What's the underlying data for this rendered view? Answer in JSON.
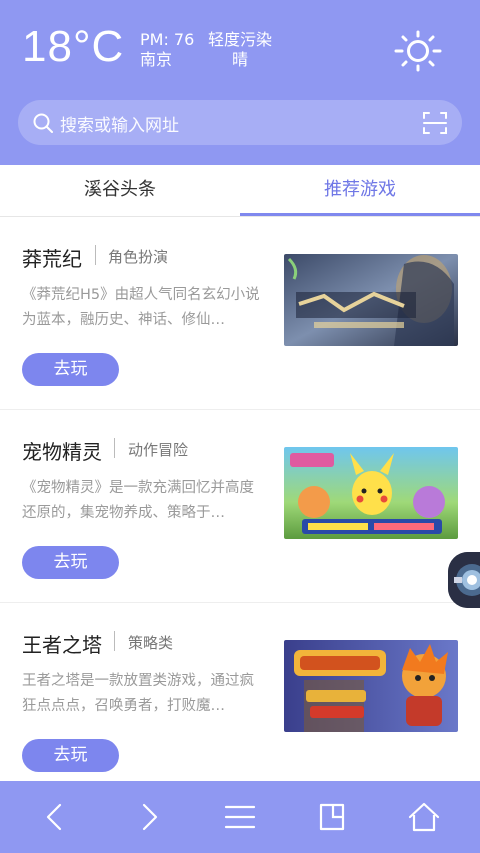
{
  "weather": {
    "temperature": "18°C",
    "pm": "PM: 76",
    "city": "南京",
    "air_quality": "轻度污染",
    "condition": "晴",
    "icon": "sun-icon"
  },
  "search": {
    "placeholder": "搜索或输入网址",
    "scan_icon": "scan-icon"
  },
  "tabs": [
    {
      "label": "溪谷头条",
      "active": false
    },
    {
      "label": "推荐游戏",
      "active": true
    }
  ],
  "games": [
    {
      "title": "莽荒纪",
      "category": "角色扮演",
      "description": "《莽荒纪H5》由超人气同名玄幻小说为蓝本，融历史、神话、修仙…",
      "button": "去玩"
    },
    {
      "title": "宠物精灵",
      "category": "动作冒险",
      "description": "《宠物精灵》是一款充满回忆并高度还原的，集宠物养成、策略于…",
      "button": "去玩"
    },
    {
      "title": "王者之塔",
      "category": "策略类",
      "description": "王者之塔是一款放置类游戏，通过疯狂点点点，召唤勇者，打败魔…",
      "button": "去玩"
    }
  ],
  "bottom_nav": [
    {
      "icon": "back-icon"
    },
    {
      "icon": "forward-icon"
    },
    {
      "icon": "menu-icon"
    },
    {
      "icon": "tabs-icon"
    },
    {
      "icon": "home-icon"
    }
  ],
  "colors": {
    "accent": "#8f98f2",
    "button": "#7d86ee",
    "active_tab": "#6f77e6"
  }
}
